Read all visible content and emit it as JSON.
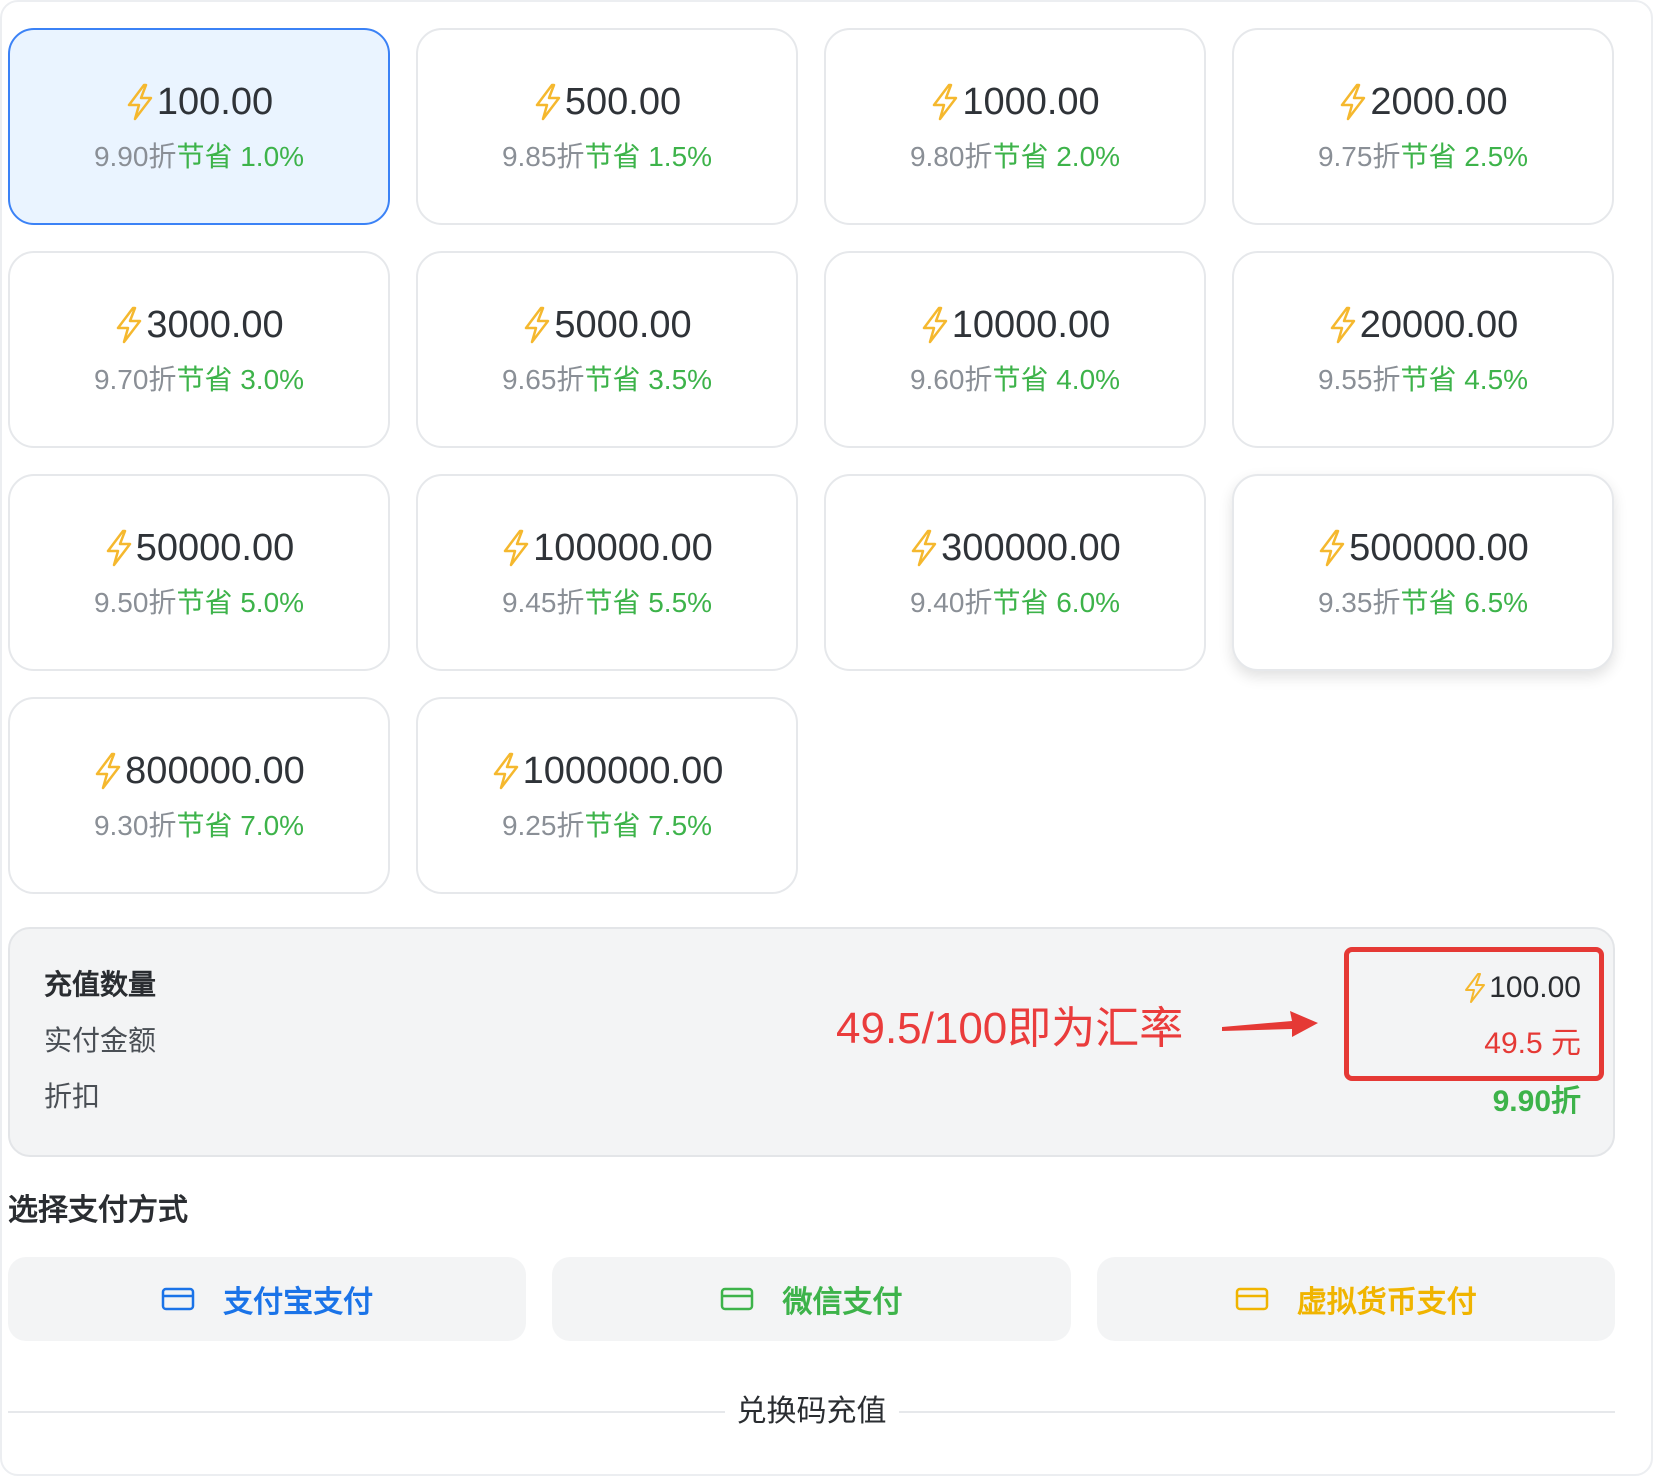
{
  "cards": [
    {
      "amount": "100.00",
      "rate": "9.90折",
      "save": "节省 1.0%",
      "selected": true
    },
    {
      "amount": "500.00",
      "rate": "9.85折",
      "save": "节省 1.5%"
    },
    {
      "amount": "1000.00",
      "rate": "9.80折",
      "save": "节省 2.0%"
    },
    {
      "amount": "2000.00",
      "rate": "9.75折",
      "save": "节省 2.5%"
    },
    {
      "amount": "3000.00",
      "rate": "9.70折",
      "save": "节省 3.0%"
    },
    {
      "amount": "5000.00",
      "rate": "9.65折",
      "save": "节省 3.5%"
    },
    {
      "amount": "10000.00",
      "rate": "9.60折",
      "save": "节省 4.0%"
    },
    {
      "amount": "20000.00",
      "rate": "9.55折",
      "save": "节省 4.5%"
    },
    {
      "amount": "50000.00",
      "rate": "9.50折",
      "save": "节省 5.0%"
    },
    {
      "amount": "100000.00",
      "rate": "9.45折",
      "save": "节省 5.5%"
    },
    {
      "amount": "300000.00",
      "rate": "9.40折",
      "save": "节省 6.0%"
    },
    {
      "amount": "500000.00",
      "rate": "9.35折",
      "save": "节省 6.5%",
      "hovered": true
    },
    {
      "amount": "800000.00",
      "rate": "9.30折",
      "save": "节省 7.0%"
    },
    {
      "amount": "1000000.00",
      "rate": "9.25折",
      "save": "节省 7.5%"
    }
  ],
  "summary": {
    "label_quantity": "充值数量",
    "label_paid": "实付金额",
    "label_discount": "折扣",
    "quantity": "100.00",
    "paid": "49.5 元",
    "discount": "9.90折",
    "annotation": "49.5/100即为汇率"
  },
  "payment": {
    "title": "选择支付方式",
    "methods": [
      {
        "label": "支付宝支付",
        "color": "#1a73e8",
        "icon": "card-icon"
      },
      {
        "label": "微信支付",
        "color": "#3db34a",
        "icon": "card-icon"
      },
      {
        "label": "虚拟货币支付",
        "color": "#f0b400",
        "icon": "card-icon"
      }
    ]
  },
  "redeem_label": "兑换码充值",
  "colors": {
    "accent": "#3b82f6",
    "selected_bg": "#eaf4ff",
    "save_green": "#3db34a",
    "highlight_red": "#e53935",
    "bolt": "#f5b82e"
  }
}
